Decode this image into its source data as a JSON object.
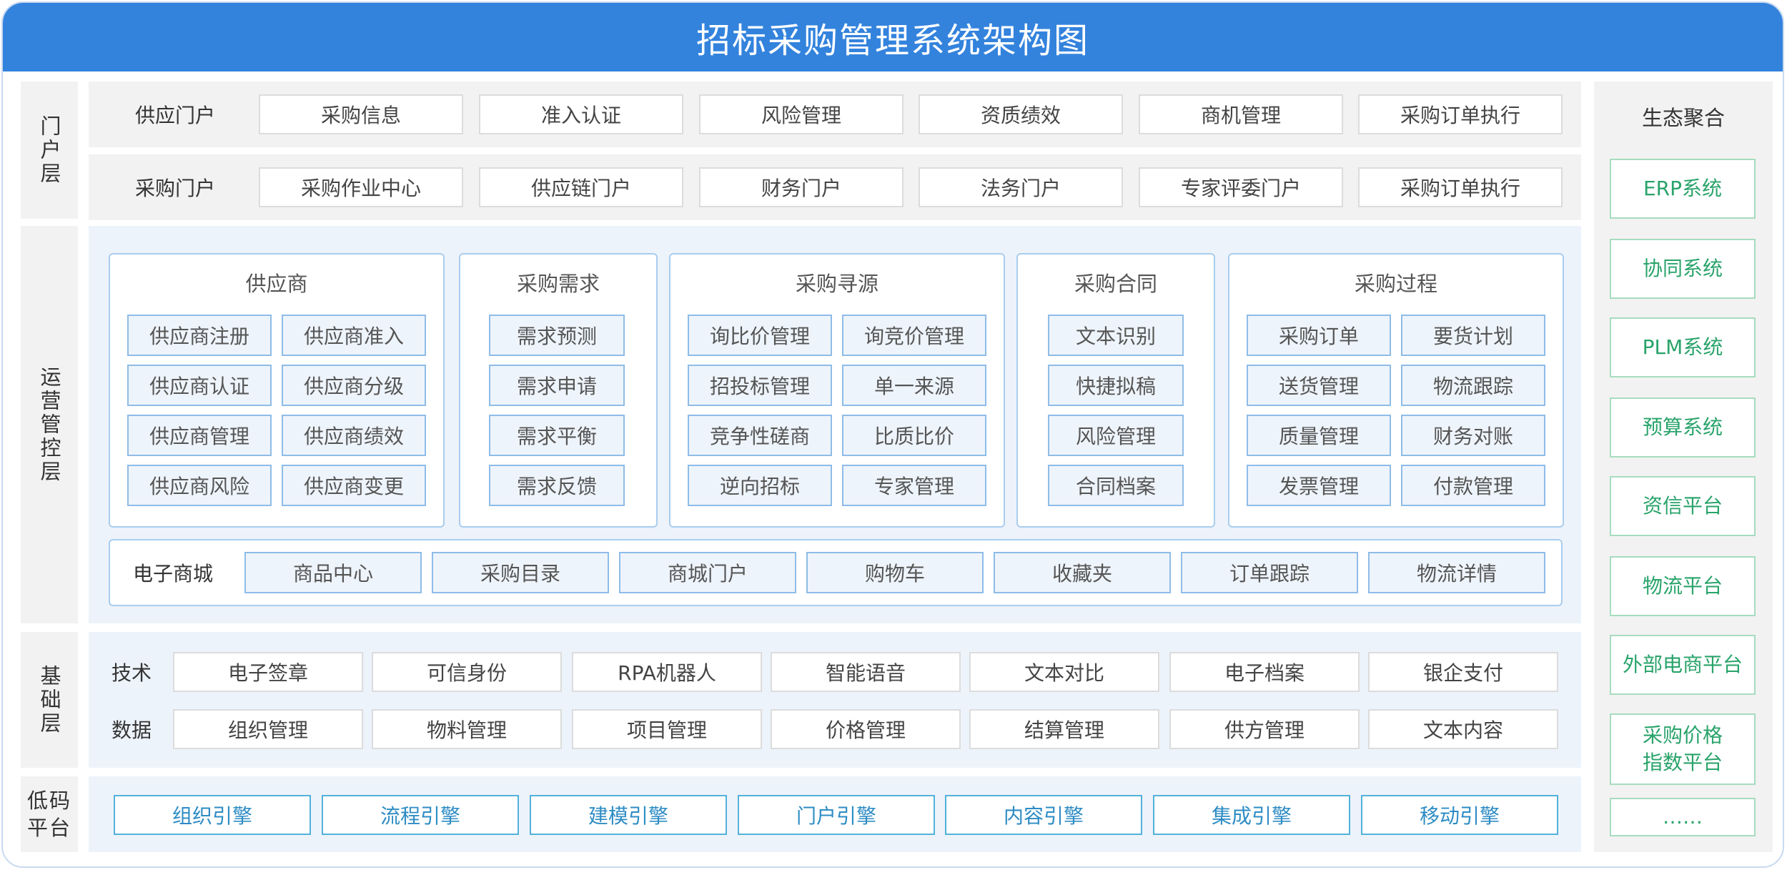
{
  "title": "招标采购管理系统架构图",
  "colors": {
    "header": "#3383dd",
    "eco_text": "#29a36a",
    "engine_text": "#2e8cc4"
  },
  "layers": {
    "portal": "门户层",
    "ops": "运营管控层",
    "base": "基础层",
    "lowcode": "低码平台"
  },
  "portal": {
    "supply": {
      "label": "供应门户",
      "items": [
        "采购信息",
        "准入认证",
        "风险管理",
        "资质绩效",
        "商机管理",
        "采购订单执行"
      ]
    },
    "purchase": {
      "label": "采购门户",
      "items": [
        "采购作业中心",
        "供应链门户",
        "财务门户",
        "法务门户",
        "专家评委门户",
        "采购订单执行"
      ]
    }
  },
  "ops": {
    "groups": [
      {
        "title": "供应商",
        "items": [
          "供应商注册",
          "供应商准入",
          "供应商认证",
          "供应商分级",
          "供应商管理",
          "供应商绩效",
          "供应商风险",
          "供应商变更"
        ]
      },
      {
        "title": "采购需求",
        "items": [
          "需求预测",
          "需求申请",
          "需求平衡",
          "需求反馈"
        ]
      },
      {
        "title": "采购寻源",
        "items": [
          "询比价管理",
          "询竞价管理",
          "招投标管理",
          "单一来源",
          "竞争性磋商",
          "比质比价",
          "逆向招标",
          "专家管理"
        ]
      },
      {
        "title": "采购合同",
        "items": [
          "文本识别",
          "快捷拟稿",
          "风险管理",
          "合同档案"
        ]
      },
      {
        "title": "采购过程",
        "items": [
          "采购订单",
          "要货计划",
          "送货管理",
          "物流跟踪",
          "质量管理",
          "财务对账",
          "发票管理",
          "付款管理"
        ]
      }
    ],
    "mall": {
      "label": "电子商城",
      "items": [
        "商品中心",
        "采购目录",
        "商城门户",
        "购物车",
        "收藏夹",
        "订单跟踪",
        "物流详情"
      ]
    }
  },
  "base": {
    "tech": {
      "label": "技术",
      "items": [
        "电子签章",
        "可信身份",
        "RPA机器人",
        "智能语音",
        "文本对比",
        "电子档案",
        "银企支付"
      ]
    },
    "data": {
      "label": "数据",
      "items": [
        "组织管理",
        "物料管理",
        "项目管理",
        "价格管理",
        "结算管理",
        "供方管理",
        "文本内容"
      ]
    }
  },
  "lowcode": {
    "items": [
      "组织引擎",
      "流程引擎",
      "建模引擎",
      "门户引擎",
      "内容引擎",
      "集成引擎",
      "移动引擎"
    ]
  },
  "ecosystem": {
    "title": "生态聚合",
    "items": [
      "ERP系统",
      "协同系统",
      "PLM系统",
      "预算系统",
      "资信平台",
      "物流平台",
      "外部电商平台",
      "采购价格指数平台",
      "……"
    ]
  }
}
